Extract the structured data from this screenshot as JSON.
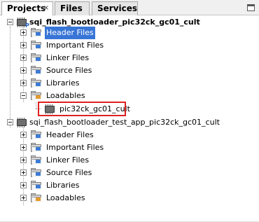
{
  "tabs": {
    "projects": "Projects",
    "files": "Files",
    "services": "Services",
    "close_glyph": "×"
  },
  "tree": {
    "project1": {
      "name": "sqi_flash_bootloader_pic32ck_gc01_cult",
      "children": {
        "header_files": "Header Files",
        "important_files": "Important Files",
        "linker_files": "Linker Files",
        "source_files": "Source Files",
        "libraries": "Libraries",
        "loadables": "Loadables",
        "loadable_item": "pic32ck_gc01_cult"
      }
    },
    "project2": {
      "name": "sqi_flash_bootloader_test_app_pic32ck_gc01_cult",
      "children": {
        "header_files": "Header Files",
        "important_files": "Important Files",
        "linker_files": "Linker Files",
        "source_files": "Source Files",
        "libraries": "Libraries",
        "loadables": "Loadables"
      }
    }
  },
  "colors": {
    "selection": "#3875d7",
    "highlight": "#e02020",
    "folder_badge": "#3c7bd6",
    "loadables_badge": "#e39b2c"
  },
  "icons": {
    "folder": "folder-icon",
    "chip": "chip-icon",
    "expander": "expand-collapse-icon",
    "maximize": "maximize-window-icon"
  }
}
